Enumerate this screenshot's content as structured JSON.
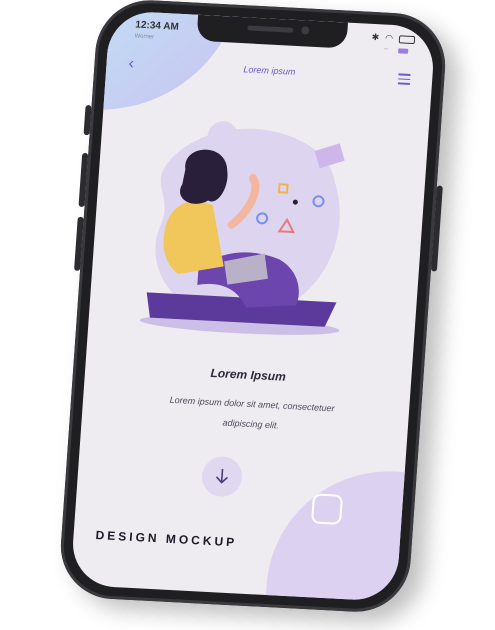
{
  "status": {
    "time": "12:34 AM",
    "sub_left": "Worner"
  },
  "nav": {
    "title": "Lorem ipsum"
  },
  "content": {
    "heading": "Lorem Ipsum",
    "body_line1": "Lorem ipsum dolor sit amet, consectetuer",
    "body_line2": "adipiscing elit."
  },
  "footer": {
    "label": "DESIGN MOCKUP"
  },
  "colors": {
    "accent": "#6b5ac7",
    "bg": "#eeebf1",
    "blob": "#ddd1f2"
  }
}
